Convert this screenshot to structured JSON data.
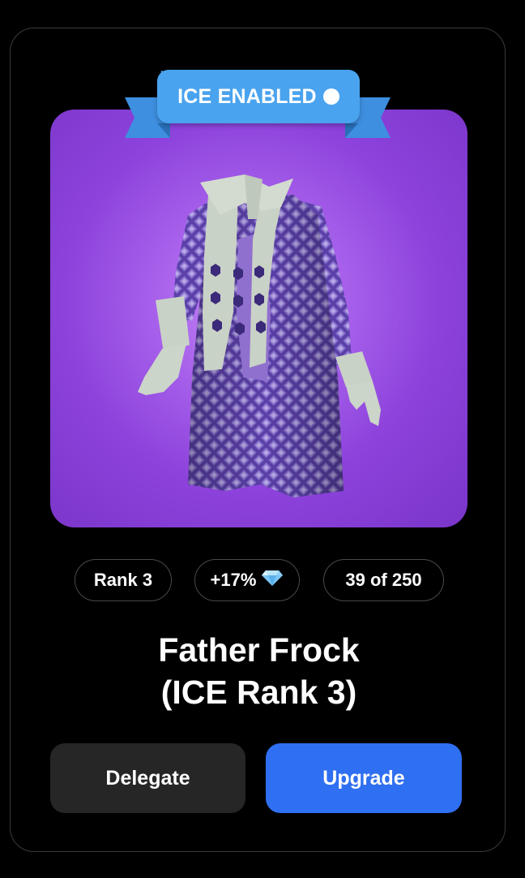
{
  "badge": {
    "label": "ICE ENABLED",
    "icon": "info-icon",
    "color": "#4aa3ee"
  },
  "item": {
    "image": "purple-frock-coat",
    "background_color": "#9b4fe6"
  },
  "stats": {
    "rank": "Rank 3",
    "bonus": "+17%",
    "bonus_icon": "diamond-icon",
    "count": "39 of 250"
  },
  "title": {
    "line1": "Father Frock",
    "line2": "(ICE Rank 3)"
  },
  "actions": {
    "delegate_label": "Delegate",
    "upgrade_label": "Upgrade",
    "upgrade_color": "#2f6ff1",
    "delegate_color": "#262626"
  }
}
